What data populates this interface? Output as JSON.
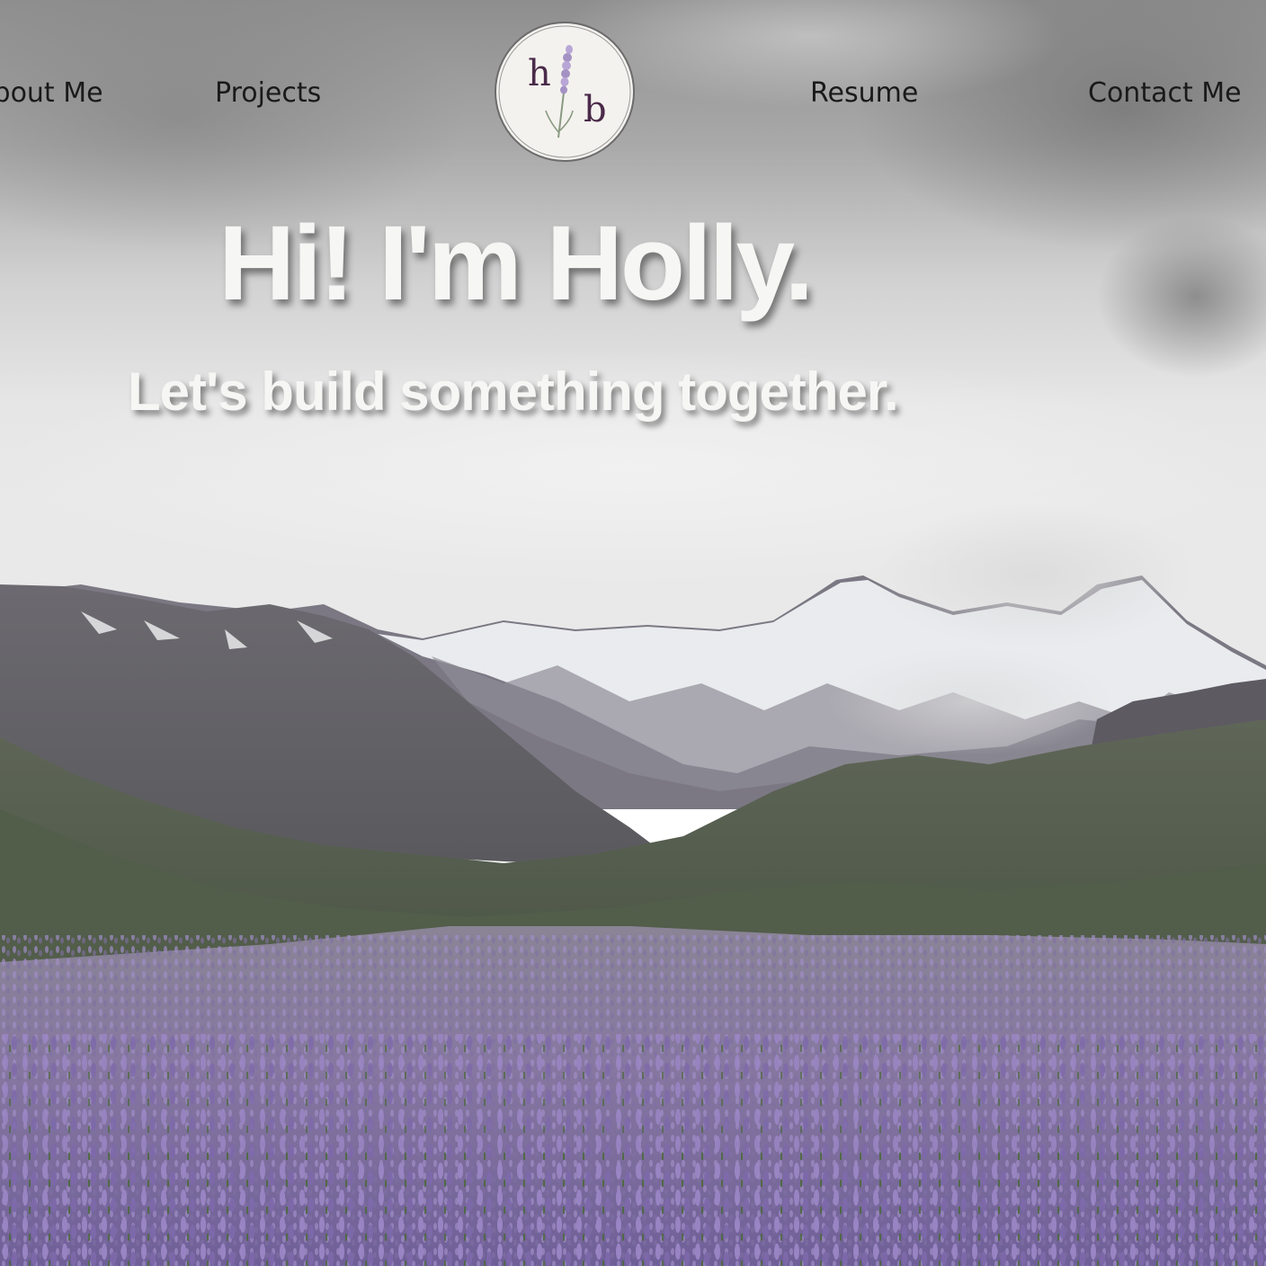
{
  "nav": {
    "about_label": "About Me",
    "projects_label": "Projects",
    "resume_label": "Resume",
    "contact_label": "Contact Me"
  },
  "logo": {
    "letter_top": "h",
    "letter_bottom": "b",
    "icon": "lavender-sprig-icon"
  },
  "hero": {
    "title": "Hi! I'm Holly.",
    "subtitle": "Let's build something together.",
    "background": "mountain-lupine-field-photo"
  },
  "colors": {
    "nav_text": "#1a1a1a",
    "hero_text": "#f6f6f5",
    "logo_bg": "#f4f2ee",
    "logo_letters": "#4a2a4a",
    "lavender": "#a592c4"
  }
}
